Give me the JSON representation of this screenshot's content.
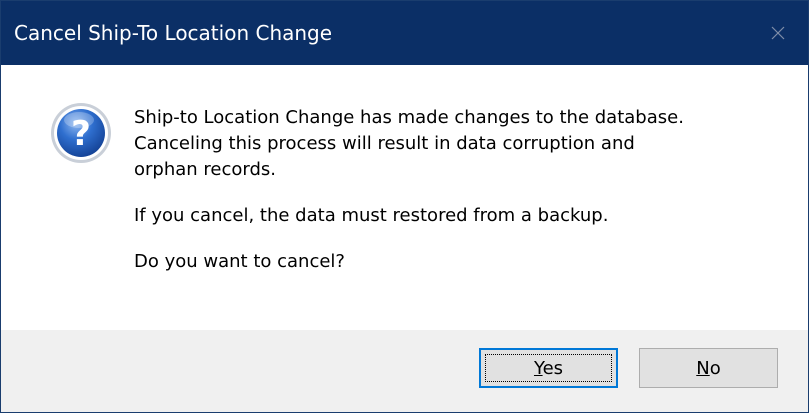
{
  "window": {
    "title": "Cancel Ship-To Location Change",
    "close_glyph": "close-icon",
    "titlebar_color": "#0b2f66"
  },
  "message": {
    "icon": "question-icon",
    "lines": [
      "Ship-to Location Change has made changes to the database.",
      "Canceling this process will result in data corruption and",
      "orphan records."
    ],
    "warning": "If you cancel, the data must restored from a backup.",
    "prompt": "Do you want to cancel?"
  },
  "buttons": {
    "yes": {
      "accel": "Y",
      "rest": "es",
      "is_default": true
    },
    "no": {
      "accel": "N",
      "rest": "o",
      "is_default": false
    }
  },
  "colors": {
    "footer_bg": "#f0f0f0",
    "button_bg": "#e1e1e1",
    "focus_border": "#0078d7"
  }
}
